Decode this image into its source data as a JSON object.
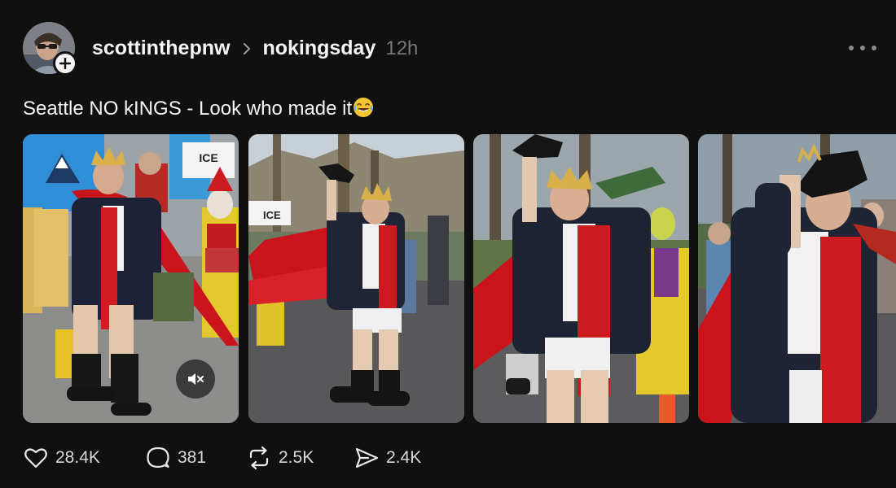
{
  "post": {
    "author": "scottinthepnw",
    "community": "nokingsday",
    "time": "12h",
    "text": "Seattle NO kINGS - Look who made it",
    "emoji": "tears-of-joy"
  },
  "media": [
    {
      "kind": "video",
      "muted": true,
      "sign_text": "ICE",
      "box_text": "ICE"
    },
    {
      "kind": "photo",
      "sign_text": "ICE"
    },
    {
      "kind": "photo"
    },
    {
      "kind": "photo"
    }
  ],
  "stats": {
    "likes": "28.4K",
    "replies": "381",
    "reposts": "2.5K",
    "shares": "2.4K"
  },
  "icons": {
    "like": "heart-icon",
    "reply": "speech-bubble-icon",
    "repost": "repost-icon",
    "share": "send-icon",
    "more": "more-dots-icon",
    "mute": "speaker-muted-icon",
    "follow": "plus-icon"
  },
  "colors": {
    "background": "#101010",
    "text": "#f3f5f7",
    "muted_text": "#777777",
    "cape_red": "#c8141a"
  }
}
